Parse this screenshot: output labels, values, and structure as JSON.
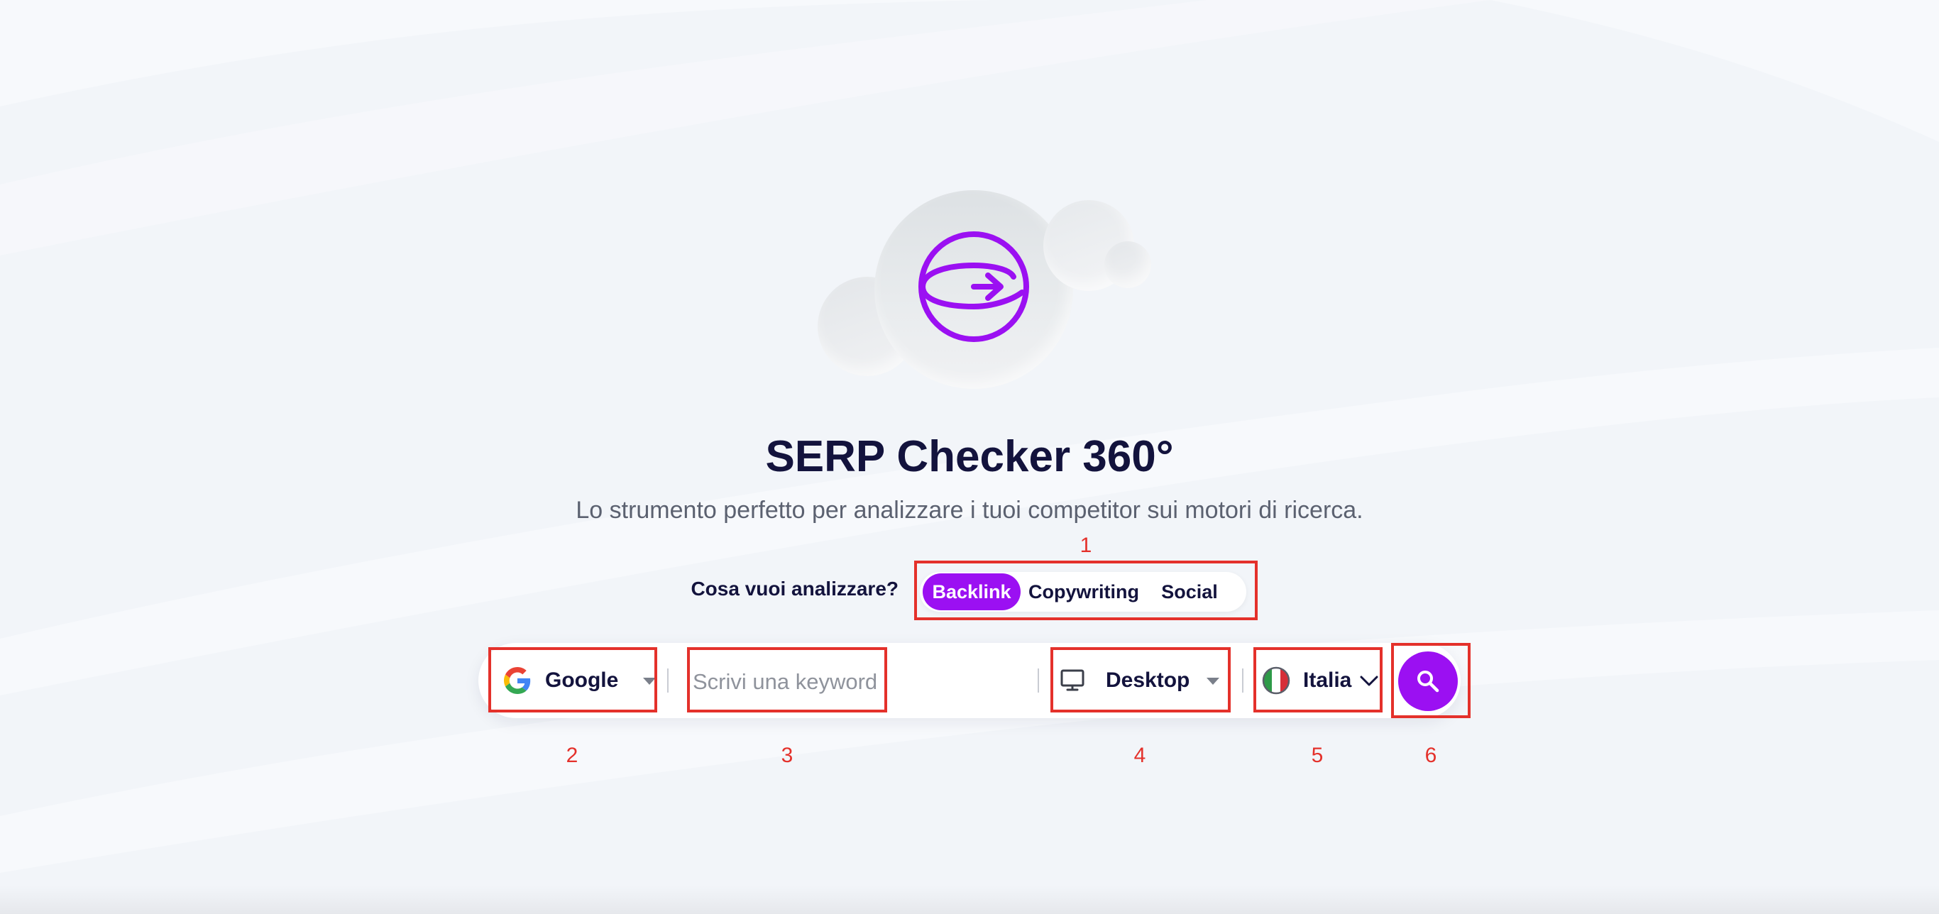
{
  "page": {
    "title": "SERP Checker 360°",
    "subtitle": "Lo strumento perfetto per analizzare i tuoi competitor sui motori di ricerca."
  },
  "analysis": {
    "question": "Cosa vuoi analizzare?",
    "options": [
      {
        "label": "Backlink",
        "selected": true
      },
      {
        "label": "Copywriting",
        "selected": false
      },
      {
        "label": "Social",
        "selected": false
      }
    ]
  },
  "search": {
    "engine": {
      "value": "Google",
      "icon": "google-icon"
    },
    "keyword": {
      "value": "",
      "placeholder": "Scrivi una keyword"
    },
    "device": {
      "value": "Desktop",
      "icon": "monitor-icon"
    },
    "country": {
      "value": "Italia",
      "icon": "italy-flag-icon"
    },
    "submit_icon": "search-icon"
  },
  "annotations": [
    "1",
    "2",
    "3",
    "4",
    "5",
    "6"
  ],
  "colors": {
    "accent": "#9B10F2",
    "background": "#F2F5F9",
    "title": "#13133D",
    "subtitle": "#5B6170",
    "annotation": "#E4312B"
  }
}
